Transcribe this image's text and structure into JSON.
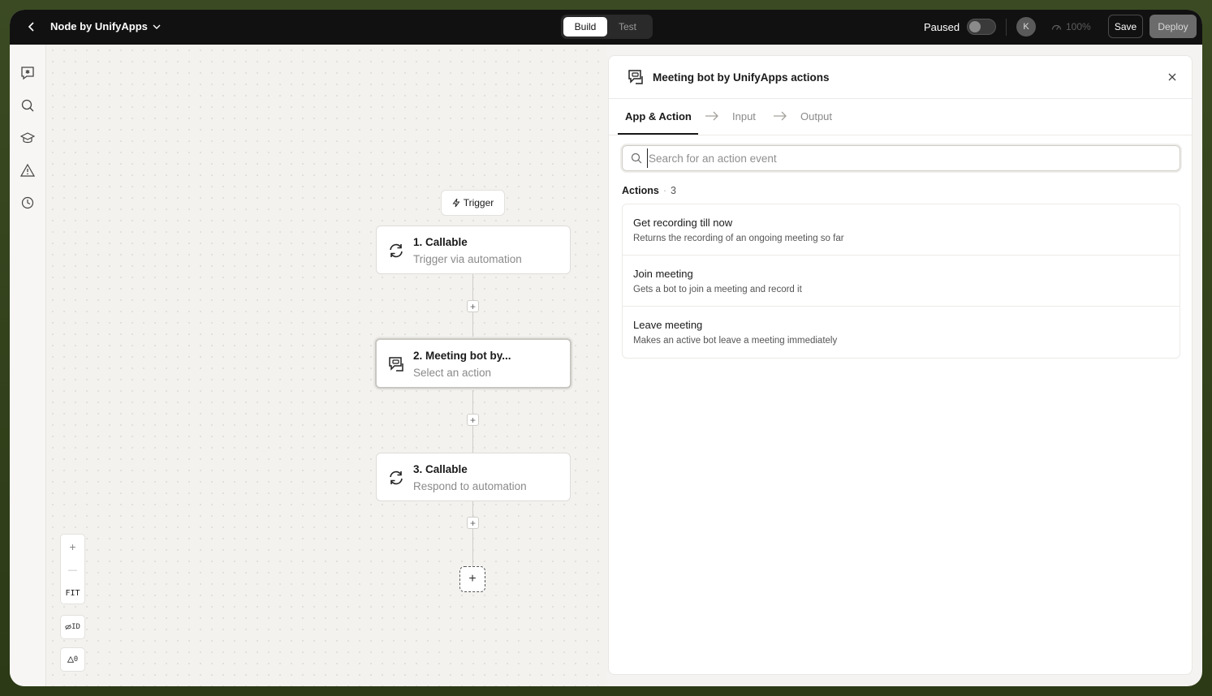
{
  "header": {
    "app_title": "Node by UnifyApps",
    "mode_build": "Build",
    "mode_test": "Test",
    "paused_label": "Paused",
    "avatar_initial": "K",
    "zoom": "100%",
    "save_label": "Save",
    "deploy_label": "Deploy"
  },
  "canvas": {
    "trigger_label": "Trigger",
    "nodes": [
      {
        "title": "1. Callable",
        "subtitle": "Trigger via automation"
      },
      {
        "title": "2. Meeting bot by...",
        "subtitle": "Select an action"
      },
      {
        "title": "3. Callable",
        "subtitle": "Respond to automation"
      }
    ],
    "zoom_controls": {
      "plus": "+",
      "minus": "—",
      "fit": "FIT"
    },
    "id_toggle": "ID",
    "warnings": "0"
  },
  "panel": {
    "title": "Meeting bot by UnifyApps actions",
    "tabs": [
      "App & Action",
      "Input",
      "Output"
    ],
    "search_placeholder": "Search for an action event",
    "actions_label": "Actions",
    "actions_count": "3",
    "actions": [
      {
        "name": "Get recording till now",
        "description": "Returns the recording of an ongoing meeting so far"
      },
      {
        "name": "Join meeting",
        "description": "Gets a bot to join a meeting and record it"
      },
      {
        "name": "Leave meeting",
        "description": "Makes an active bot leave a meeting immediately"
      }
    ]
  },
  "colors": {
    "topbar": "#111111",
    "canvas": "#f3f2ef",
    "frame_outer": "#3b4a22"
  }
}
